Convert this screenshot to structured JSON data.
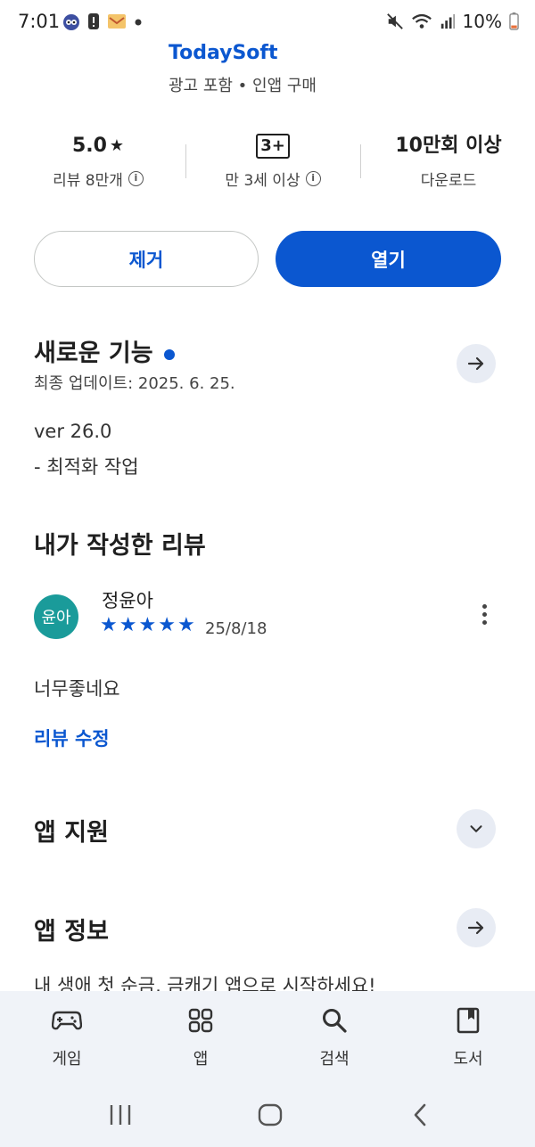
{
  "status": {
    "time": "7:01",
    "battery": "10%"
  },
  "app": {
    "developer": "TodaySoft",
    "meta": "광고 포함 • 인앱 구매"
  },
  "stats": {
    "rating": "5.0",
    "rating_label": "리뷰 8만개",
    "age_badge": "3+",
    "age_label": "만 3세 이상",
    "downloads": "10만회 이상",
    "downloads_label": "다운로드"
  },
  "actions": {
    "remove_label": "제거",
    "open_label": "열기"
  },
  "whats_new": {
    "title": "새로운 기능",
    "updated": "최종 업데이트: 2025. 6. 25.",
    "version": "ver 26.0",
    "note": "- 최적화 작업"
  },
  "my_review": {
    "title": "내가 작성한 리뷰",
    "avatar_text": "윤아",
    "reviewer": "정윤아",
    "stars": 5,
    "date": "25/8/18",
    "body": "너무좋네요",
    "edit_label": "리뷰 수정"
  },
  "support": {
    "title": "앱 지원"
  },
  "about": {
    "title": "앱 정보",
    "description": "내 생애 첫 순금, 금캐기 앱으로 시작하세요!"
  },
  "nav": {
    "games": "게임",
    "apps": "앱",
    "search": "검색",
    "books": "도서"
  },
  "colors": {
    "accent": "#0b57d0",
    "avatar_bg": "#1a9b9a",
    "nav_bg": "#f0f3f8"
  }
}
